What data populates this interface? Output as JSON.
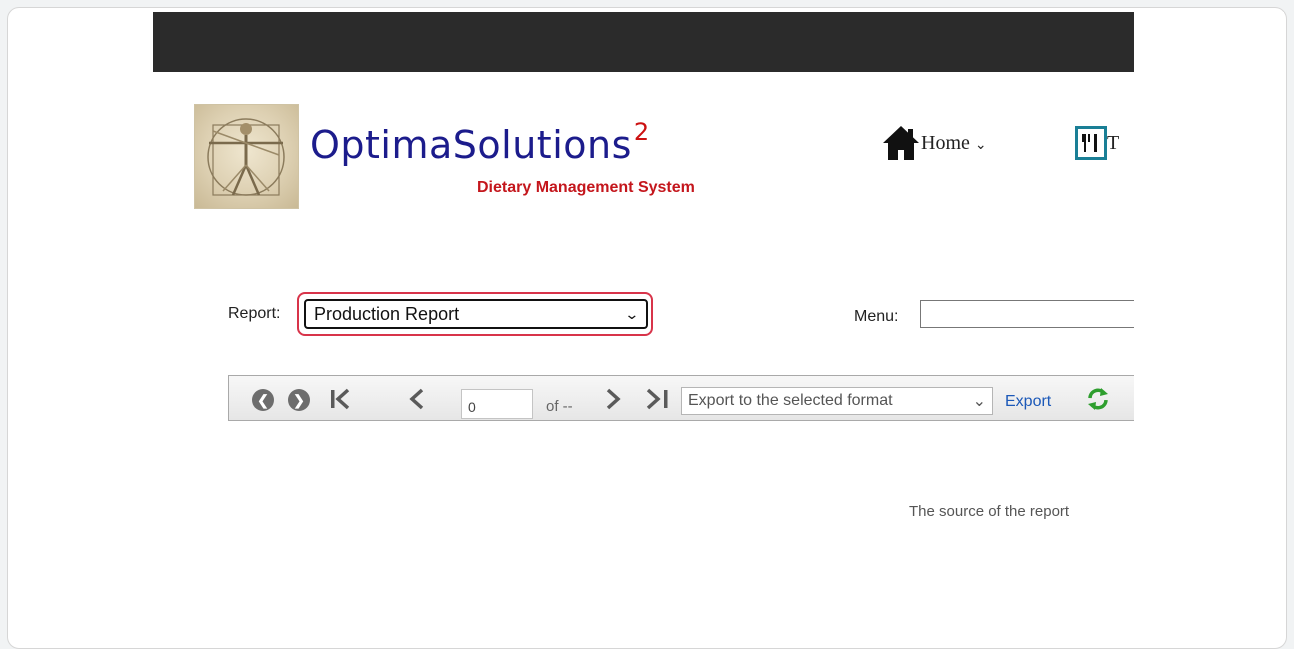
{
  "header": {
    "brand": "OptimaSolutions",
    "brand_superscript": "2",
    "tagline": "Dietary Management System"
  },
  "nav": {
    "home_label": "Home",
    "menu2_label_partial": "T"
  },
  "filters": {
    "report_label": "Report:",
    "report_selected": "Production Report",
    "menu_label": "Menu:",
    "menu_value": ""
  },
  "viewer_toolbar": {
    "page_value": "0",
    "of_label": "of --",
    "export_format_selected": "Export to the selected format",
    "export_label": "Export"
  },
  "viewer_body": {
    "message": "The source of the report"
  },
  "colors": {
    "brand_blue": "#1c1c8c",
    "tagline_red": "#c4161c",
    "highlight": "#d8344a",
    "link_blue": "#1b58b8"
  }
}
